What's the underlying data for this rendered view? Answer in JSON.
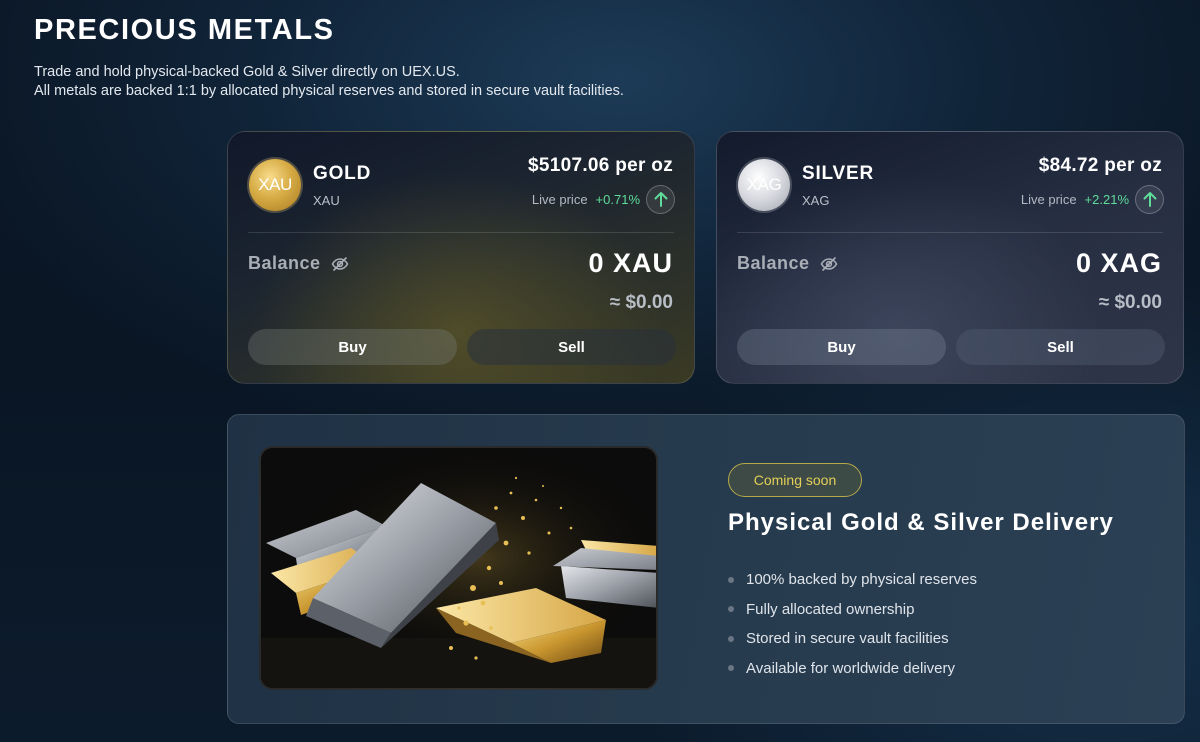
{
  "header": {
    "title": "PRECIOUS METALS",
    "subtitle_line1": "Trade and hold physical-backed Gold & Silver directly on UEX.US.",
    "subtitle_line2": "All metals are backed 1:1 by allocated physical reserves and stored in secure vault facilities."
  },
  "cards": [
    {
      "coin_label": "XAU",
      "name": "GOLD",
      "code": "XAU",
      "price": "$5107.06 per oz",
      "live_label": "Live price",
      "change": "+0.71%",
      "change_icon": "arrow-up-icon",
      "balance_label": "Balance",
      "balance_icon": "eye-off-icon",
      "balance_amount": "0 XAU",
      "balance_usd": "≈ $0.00",
      "buy_label": "Buy",
      "sell_label": "Sell",
      "accent": "#d7ac46"
    },
    {
      "coin_label": "XAG",
      "name": "SILVER",
      "code": "XAG",
      "price": "$84.72 per oz",
      "live_label": "Live price",
      "change": "+2.21%",
      "change_icon": "arrow-up-icon",
      "balance_label": "Balance",
      "balance_icon": "eye-off-icon",
      "balance_amount": "0 XAG",
      "balance_usd": "≈ $0.00",
      "buy_label": "Buy",
      "sell_label": "Sell",
      "accent": "#d6d8de"
    }
  ],
  "delivery": {
    "badge": "Coming soon",
    "title": "Physical Gold & Silver Delivery",
    "features": [
      "100% backed by physical reserves",
      "Fully allocated ownership",
      "Stored in secure vault facilities",
      "Available for worldwide delivery"
    ]
  },
  "colors": {
    "positive": "#5fdc9a",
    "badge_text": "#e4cf57",
    "background": "#0b1726"
  }
}
